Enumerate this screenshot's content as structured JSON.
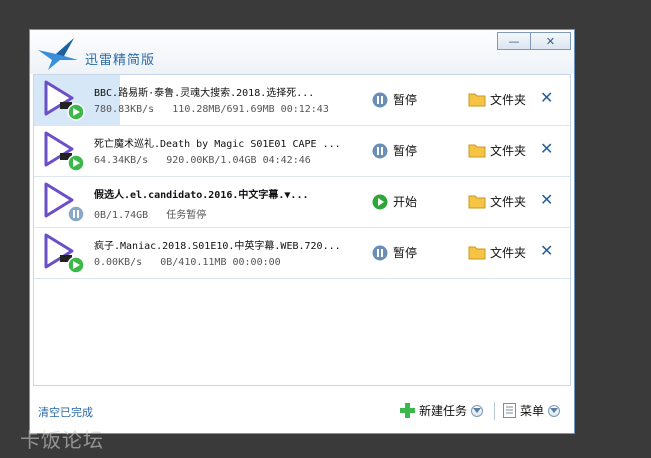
{
  "app": {
    "title": "迅雷精简版"
  },
  "window_controls": {
    "minimize": "—",
    "close": "✕"
  },
  "tasks": [
    {
      "name": "BBC.路易斯·泰鲁.灵魂大搜索.2018.选择死...",
      "speed": "780.83KB/s",
      "progress": "110.28MB/691.69MB",
      "eta": "00:12:43",
      "action_label": "暂停",
      "action_icon": "pause-icon",
      "status_icon": "play-badge-icon",
      "folder_label": "文件夹"
    },
    {
      "name": "死亡魔术巡礼.Death by Magic S01E01 CAPE ...",
      "speed": "64.34KB/s",
      "progress": "920.00KB/1.04GB",
      "eta": "04:42:46",
      "action_label": "暂停",
      "action_icon": "pause-icon",
      "status_icon": "play-badge-icon",
      "folder_label": "文件夹"
    },
    {
      "name": "假选人.el.candidato.2016.中文字幕.▼...",
      "speed": "0B/1.74GB",
      "progress": "任务暂停",
      "eta": "",
      "action_label": "开始",
      "action_icon": "play-icon",
      "status_icon": "pause-badge-icon",
      "folder_label": "文件夹"
    },
    {
      "name": "疯子.Maniac.2018.S01E10.中英字幕.WEB.720...",
      "speed": "0.00KB/s",
      "progress": "0B/410.11MB",
      "eta": "00:00:00",
      "action_label": "暂停",
      "action_icon": "pause-icon",
      "status_icon": "play-badge-icon",
      "folder_label": "文件夹"
    }
  ],
  "footer": {
    "clear_label": "清空已完成",
    "new_task_label": "新建任务",
    "menu_label": "菜单"
  },
  "watermark": "卡饭论坛",
  "colors": {
    "accent": "#2a6aa8",
    "window_border": "#6d94bd",
    "background": "#3a3a3a"
  }
}
